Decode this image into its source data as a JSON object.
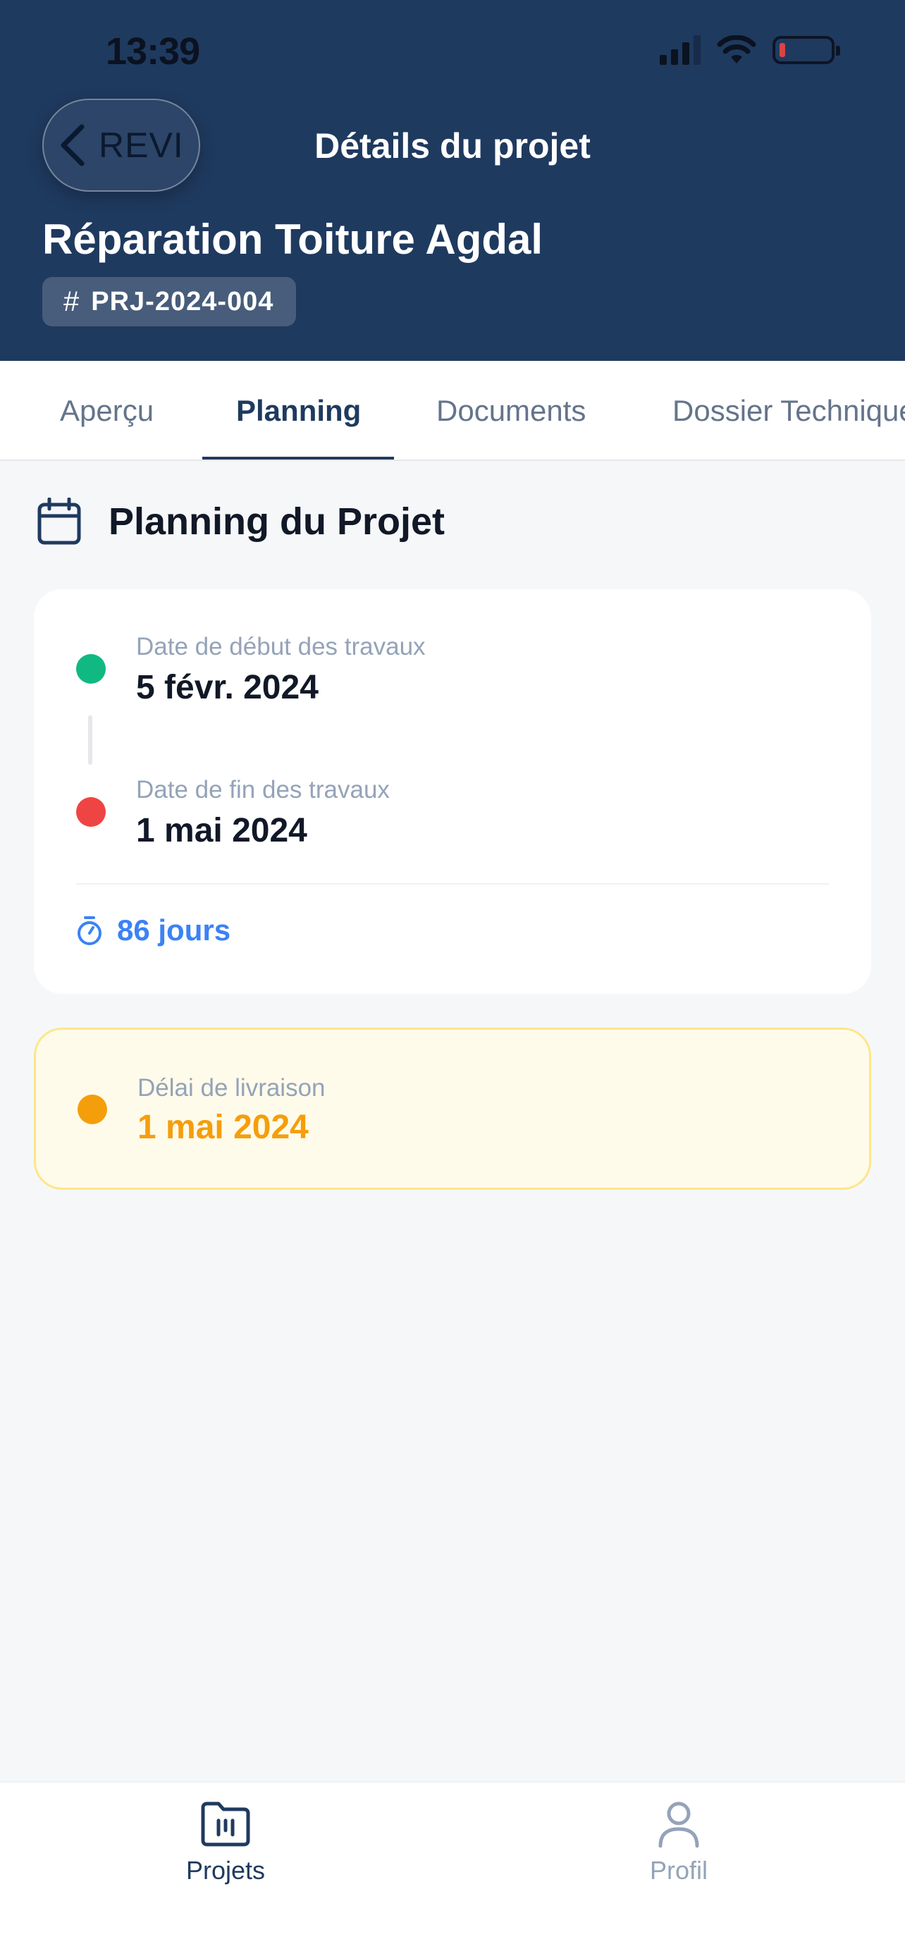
{
  "status_bar": {
    "time": "13:39"
  },
  "header": {
    "back_label": "REVI",
    "title": "Détails du projet",
    "project_name": "Réparation Toiture Agdal",
    "project_ref": "PRJ-2024-004",
    "ref_symbol": "#"
  },
  "tabs": [
    {
      "label": "Aperçu",
      "active": false
    },
    {
      "label": "Planning",
      "active": true
    },
    {
      "label": "Documents",
      "active": false
    },
    {
      "label": "Dossier Technique",
      "active": false
    }
  ],
  "planning": {
    "section_title": "Planning du Projet",
    "start": {
      "label": "Date de début des travaux",
      "value": "5 févr. 2024"
    },
    "end": {
      "label": "Date de fin des travaux",
      "value": "1 mai 2024"
    },
    "duration": "86 jours",
    "delivery": {
      "label": "Délai de livraison",
      "value": "1 mai 2024"
    }
  },
  "bottom_nav": [
    {
      "label": "Projets",
      "active": true
    },
    {
      "label": "Profil",
      "active": false
    }
  ],
  "colors": {
    "brand": "#1f3a5f",
    "start_dot": "#10b981",
    "end_dot": "#ef4444",
    "delivery_accent": "#f59e0b",
    "duration_accent": "#3b82f6"
  }
}
